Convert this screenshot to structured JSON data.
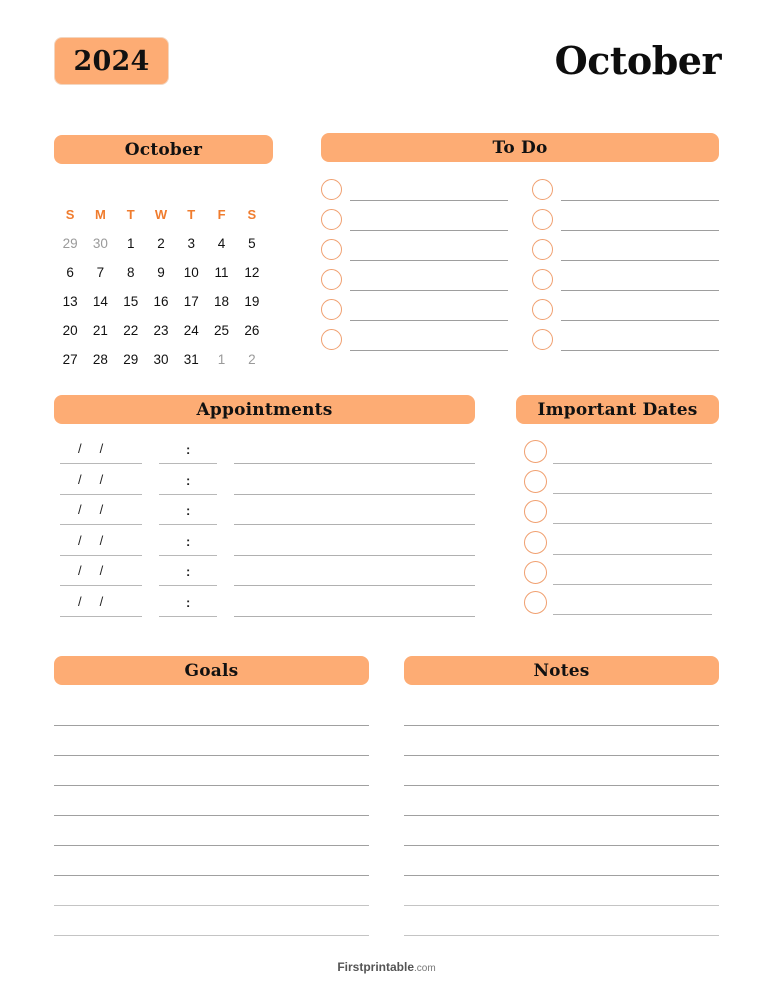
{
  "header": {
    "year": "2024",
    "month_title": "October"
  },
  "calendar": {
    "title": "October",
    "weekdays": [
      "S",
      "M",
      "T",
      "W",
      "T",
      "F",
      "S"
    ],
    "weeks": [
      [
        {
          "d": "29",
          "muted": true
        },
        {
          "d": "30",
          "muted": true
        },
        {
          "d": "1"
        },
        {
          "d": "2"
        },
        {
          "d": "3"
        },
        {
          "d": "4"
        },
        {
          "d": "5"
        }
      ],
      [
        {
          "d": "6"
        },
        {
          "d": "7"
        },
        {
          "d": "8"
        },
        {
          "d": "9"
        },
        {
          "d": "10"
        },
        {
          "d": "11"
        },
        {
          "d": "12"
        }
      ],
      [
        {
          "d": "13"
        },
        {
          "d": "14"
        },
        {
          "d": "15"
        },
        {
          "d": "16"
        },
        {
          "d": "17"
        },
        {
          "d": "18"
        },
        {
          "d": "19"
        }
      ],
      [
        {
          "d": "20"
        },
        {
          "d": "21"
        },
        {
          "d": "22"
        },
        {
          "d": "23"
        },
        {
          "d": "24"
        },
        {
          "d": "25"
        },
        {
          "d": "26"
        }
      ],
      [
        {
          "d": "27"
        },
        {
          "d": "28"
        },
        {
          "d": "29"
        },
        {
          "d": "30"
        },
        {
          "d": "31"
        },
        {
          "d": "1",
          "muted": true
        },
        {
          "d": "2",
          "muted": true
        }
      ]
    ]
  },
  "todo": {
    "title": "To Do",
    "items_per_column": 6,
    "columns": 2
  },
  "appointments": {
    "title": "Appointments",
    "rows": 6,
    "date_placeholder": "/     /",
    "time_placeholder": ":"
  },
  "important_dates": {
    "title": "Important Dates",
    "items": 6
  },
  "goals": {
    "title": "Goals",
    "lines": 8
  },
  "notes": {
    "title": "Notes",
    "lines": 8
  },
  "footer": {
    "brand": "Firstprintable",
    "tld": ".com"
  },
  "colors": {
    "accent": "#fdac74",
    "weekday": "#f07c2e",
    "circle": "#f0a070",
    "rule": "#9e9e9e"
  }
}
